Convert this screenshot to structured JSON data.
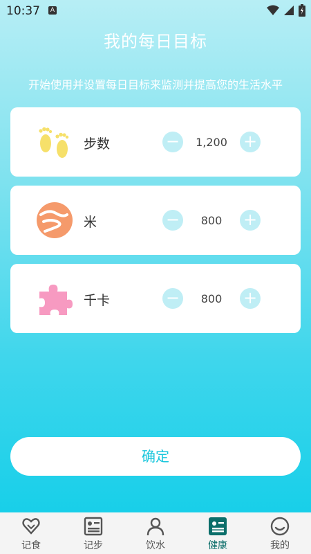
{
  "status": {
    "time": "10:37",
    "notif_badge": "A"
  },
  "header": {
    "title": "我的每日目标",
    "subtitle": "开始使用并设置每日目标来监测并提高您的生活水平"
  },
  "goals": [
    {
      "label": "步数",
      "value": "1,200",
      "icon": "footprints-icon",
      "color": "#f6e06a"
    },
    {
      "label": "米",
      "value": "800",
      "icon": "route-icon",
      "color": "#f59a6b"
    },
    {
      "label": "千卡",
      "value": "800",
      "icon": "puzzle-icon",
      "color": "#f79ac1"
    }
  ],
  "controls": {
    "minus": "−",
    "plus": "+"
  },
  "confirm": {
    "label": "确定"
  },
  "nav": [
    {
      "label": "记食",
      "icon": "heart-icon"
    },
    {
      "label": "记步",
      "icon": "list-card-icon"
    },
    {
      "label": "饮水",
      "icon": "person-icon"
    },
    {
      "label": "健康",
      "icon": "health-card-icon",
      "active": true
    },
    {
      "label": "我的",
      "icon": "smiley-icon"
    }
  ],
  "colors": {
    "accent": "#18c6dc",
    "nav_active": "#0b6e6a",
    "button_light": "#bfeef5"
  }
}
